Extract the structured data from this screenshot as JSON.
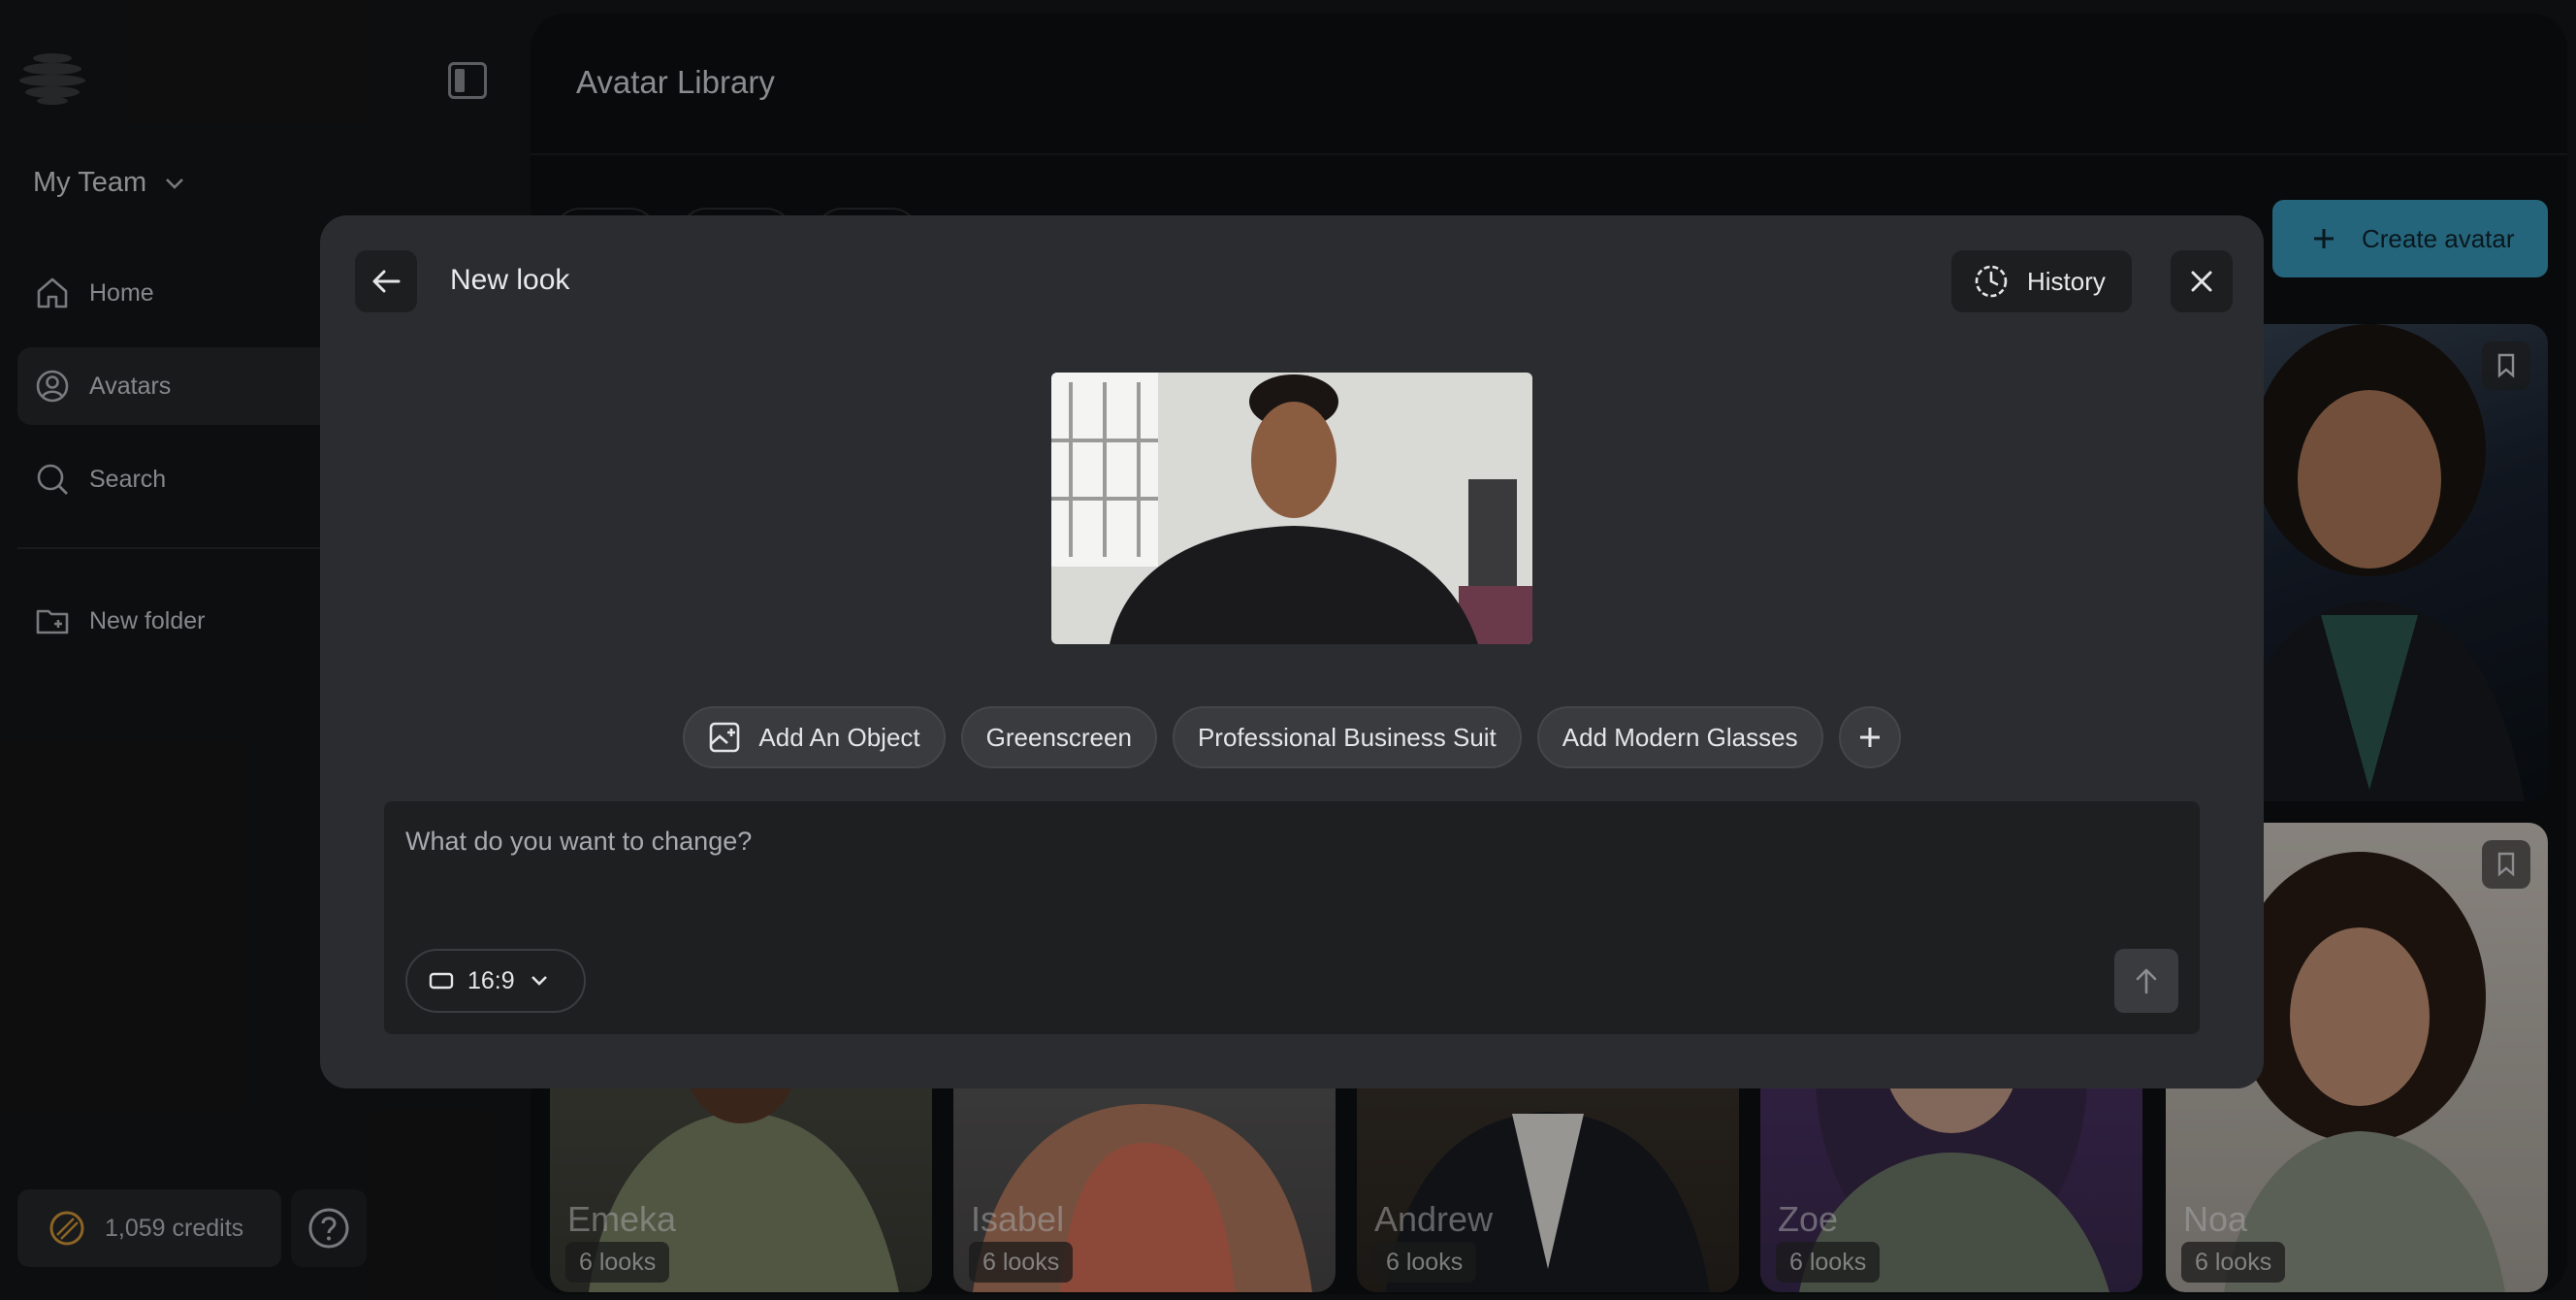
{
  "sidebar": {
    "team": "My Team",
    "nav": [
      {
        "label": "Home",
        "icon": "home-icon"
      },
      {
        "label": "Avatars",
        "icon": "user-circle-icon",
        "active": true
      },
      {
        "label": "Search",
        "icon": "search-icon"
      }
    ],
    "new_folder": "New folder",
    "credits": "1,059 credits"
  },
  "main": {
    "title": "Avatar Library",
    "create_label": "Create avatar",
    "cards": [
      {
        "name": "Emeka",
        "looks": "6 looks"
      },
      {
        "name": "Isabel",
        "looks": "6 looks"
      },
      {
        "name": "Andrew",
        "looks": "6 looks"
      },
      {
        "name": "Zoe",
        "looks": "6 looks"
      },
      {
        "name": "Noa",
        "looks": "6 looks"
      }
    ]
  },
  "modal": {
    "title": "New look",
    "history_label": "History",
    "chips": [
      {
        "label": "Add An Object",
        "icon": "image-plus-icon"
      },
      {
        "label": "Greenscreen"
      },
      {
        "label": "Professional Business Suit"
      },
      {
        "label": "Add Modern Glasses"
      }
    ],
    "prompt_placeholder": "What do you want to change?",
    "aspect_ratio": "16:9"
  },
  "colors": {
    "accent": "#3a9bbd",
    "background": "#151617",
    "modal": "#2b2c2f"
  }
}
